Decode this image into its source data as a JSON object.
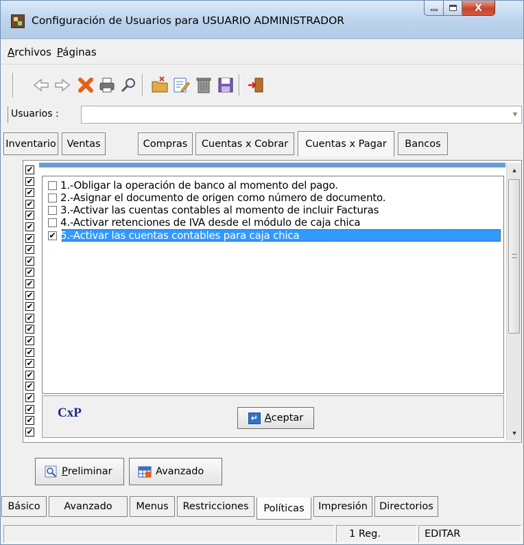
{
  "window": {
    "title": "Configuración de Usuarios para USUARIO ADMINISTRADOR",
    "close_glyph": "X"
  },
  "menu": {
    "items": [
      {
        "accel": "A",
        "rest": "rchivos"
      },
      {
        "accel": "P",
        "rest": "áginas"
      }
    ]
  },
  "toolbar": {
    "icons": [
      "back-arrow-icon",
      "forward-arrow-icon",
      "delete-x-icon",
      "print-icon",
      "search-icon",
      "new-folder-icon",
      "edit-icon",
      "trash-icon",
      "save-icon",
      "exit-icon"
    ]
  },
  "usuarios": {
    "label": "Usuarios :",
    "value": ""
  },
  "top_tabs": [
    {
      "label": "Inventario"
    },
    {
      "label": "Ventas"
    },
    {
      "label": "Compras"
    },
    {
      "label": "Cuentas x Cobrar"
    },
    {
      "label": "Cuentas x Pagar",
      "active": true
    },
    {
      "label": "Bancos"
    }
  ],
  "options": [
    {
      "text": "1.-Obligar la operación de banco al momento del pago.",
      "checked": false
    },
    {
      "text": "2.-Asignar el documento de origen como número de documento.",
      "checked": false
    },
    {
      "text": "3.-Activar las cuentas contables al momento de incluir Facturas",
      "checked": false
    },
    {
      "text": "4.-Activar retenciones de IVA desde el módulo de caja chica",
      "checked": false
    },
    {
      "text": "5.-Activar las cuentas contables para caja chica",
      "checked": true,
      "selected": true
    }
  ],
  "left_checks_count": 24,
  "panel": {
    "module_label": "CxP",
    "accept": {
      "accel": "A",
      "rest": "ceptar"
    }
  },
  "buttons": {
    "preliminar": {
      "accel": "P",
      "rest": "reliminar"
    },
    "avanzado": "Avanzado"
  },
  "bottom_tabs": [
    {
      "label": "Básico"
    },
    {
      "label": "Avanzado"
    },
    {
      "label": "Menus"
    },
    {
      "label": "Restricciones"
    },
    {
      "label": "Políticas",
      "active": true
    },
    {
      "label": "Impresión"
    },
    {
      "label": "Directorios"
    }
  ],
  "status": {
    "left": "",
    "records": "1 Reg.",
    "mode": "EDITAR"
  },
  "colors": {
    "selection": "#3399ff",
    "module_label": "#1a2a8a"
  }
}
